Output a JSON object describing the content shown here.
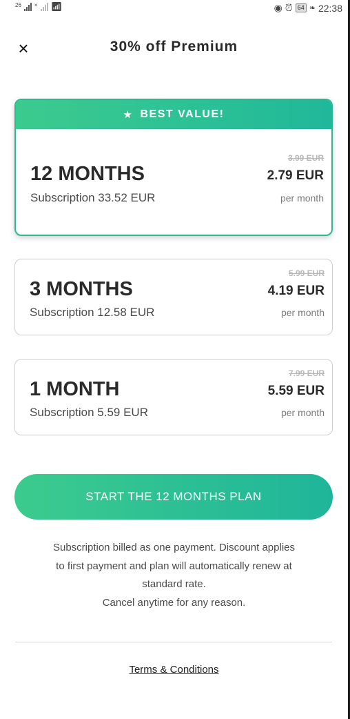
{
  "status_bar": {
    "network_left": "26",
    "network_right": "×",
    "battery": "64",
    "time": "22:38"
  },
  "header": {
    "close_icon": "×",
    "title": "30% off Premium"
  },
  "featured": {
    "ribbon_icon": "★",
    "ribbon_label": "BEST VALUE!"
  },
  "plans": [
    {
      "name": "12 MONTHS",
      "subscription": "Subscription 33.52 EUR",
      "old_price": "3.99 EUR",
      "price": "2.79 EUR",
      "period": "per month"
    },
    {
      "name": "3 MONTHS",
      "subscription": "Subscription 12.58 EUR",
      "old_price": "5.99 EUR",
      "price": "4.19 EUR",
      "period": "per month"
    },
    {
      "name": "1 MONTH",
      "subscription": "Subscription 5.59 EUR",
      "old_price": "7.99 EUR",
      "price": "5.59 EUR",
      "period": "per month"
    }
  ],
  "cta": {
    "label": "START THE 12 MONTHS PLAN"
  },
  "disclaimer": {
    "line1": "Subscription billed as one payment. Discount applies",
    "line2": "to first payment and plan will automatically renew at",
    "line3": "standard rate.",
    "line4": "Cancel anytime for any reason."
  },
  "footer": {
    "terms_label": "Terms & Conditions"
  },
  "colors": {
    "accent_start": "#3ccb8e",
    "accent_end": "#1fb59a",
    "featured_border": "#2cb78f"
  }
}
